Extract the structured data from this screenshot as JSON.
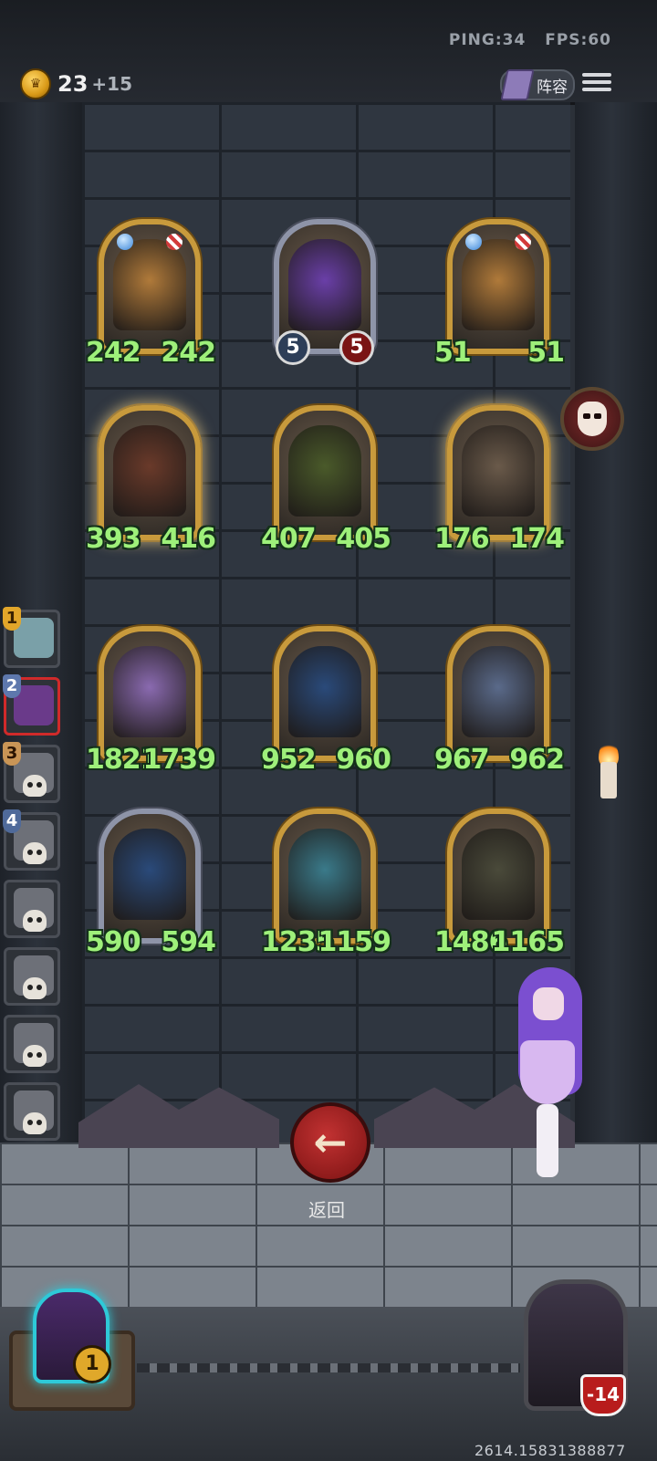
{
  "header": {
    "ping": "PING:34",
    "fps": "FPS:60",
    "gold": "23",
    "gold_income": "+15",
    "lineup_label": "阵容"
  },
  "board": {
    "rows": [
      [
        {
          "name": "raccoon-minion",
          "atk": "242",
          "hp": "242",
          "style": "gold",
          "gems": true,
          "portrait_color": "#b07a3a"
        },
        {
          "name": "purple-wizard-minion",
          "atk": "5",
          "hp": "5",
          "style": "silver",
          "badge": true,
          "portrait_color": "#6a3fa8"
        },
        {
          "name": "raccoon-minion",
          "atk": "51",
          "hp": "51",
          "style": "gold",
          "gems": true,
          "portrait_color": "#b07a3a"
        }
      ],
      [
        {
          "name": "boar-minion",
          "atk": "393",
          "hp": "416",
          "style": "gold",
          "glow": true,
          "portrait_color": "#6a3a2a"
        },
        {
          "name": "tiki-owl-minion",
          "atk": "407",
          "hp": "405",
          "style": "gold",
          "portrait_color": "#4a5a2a"
        },
        {
          "name": "masked-rabbit-minion",
          "atk": "176",
          "hp": "174",
          "style": "gold",
          "glow": true,
          "portrait_color": "#6a5a4a"
        }
      ],
      [
        {
          "name": "white-fur-lady-minion",
          "atk": "1821",
          "hp": "1739",
          "style": "gold",
          "portrait_color": "#8a6ab0"
        },
        {
          "name": "blue-crystal-beast-minion",
          "atk": "952",
          "hp": "960",
          "style": "gold",
          "portrait_color": "#2a4a7a"
        },
        {
          "name": "dwarf-king-minion",
          "atk": "967",
          "hp": "962",
          "style": "gold",
          "portrait_color": "#5a6a8a"
        }
      ],
      [
        {
          "name": "blue-crystal-beast-minion",
          "atk": "590",
          "hp": "594",
          "style": "silver",
          "portrait_color": "#2a4a7a"
        },
        {
          "name": "mushroom-mermaid-minion",
          "atk": "1235",
          "hp": "1159",
          "style": "gold",
          "portrait_color": "#3a7a8a"
        },
        {
          "name": "mushroom-spider-minion",
          "atk": "1486",
          "hp": "1165",
          "style": "gold",
          "portrait_color": "#4a4a3a"
        }
      ]
    ]
  },
  "players": [
    {
      "rank": "1",
      "eliminated": false,
      "active": false
    },
    {
      "rank": "2",
      "eliminated": false,
      "active": true
    },
    {
      "rank": "3",
      "eliminated": true,
      "active": false
    },
    {
      "rank": "4",
      "eliminated": true,
      "active": false
    },
    {
      "rank": "",
      "eliminated": true,
      "active": false
    },
    {
      "rank": "",
      "eliminated": true,
      "active": false
    },
    {
      "rank": "",
      "eliminated": true,
      "active": false
    },
    {
      "rank": "",
      "eliminated": true,
      "active": false
    }
  ],
  "back": {
    "icon": "←",
    "label": "返回"
  },
  "footer": {
    "my_level": "1",
    "opponent_hp": "-14",
    "debug_id": "2614.15831388877"
  }
}
